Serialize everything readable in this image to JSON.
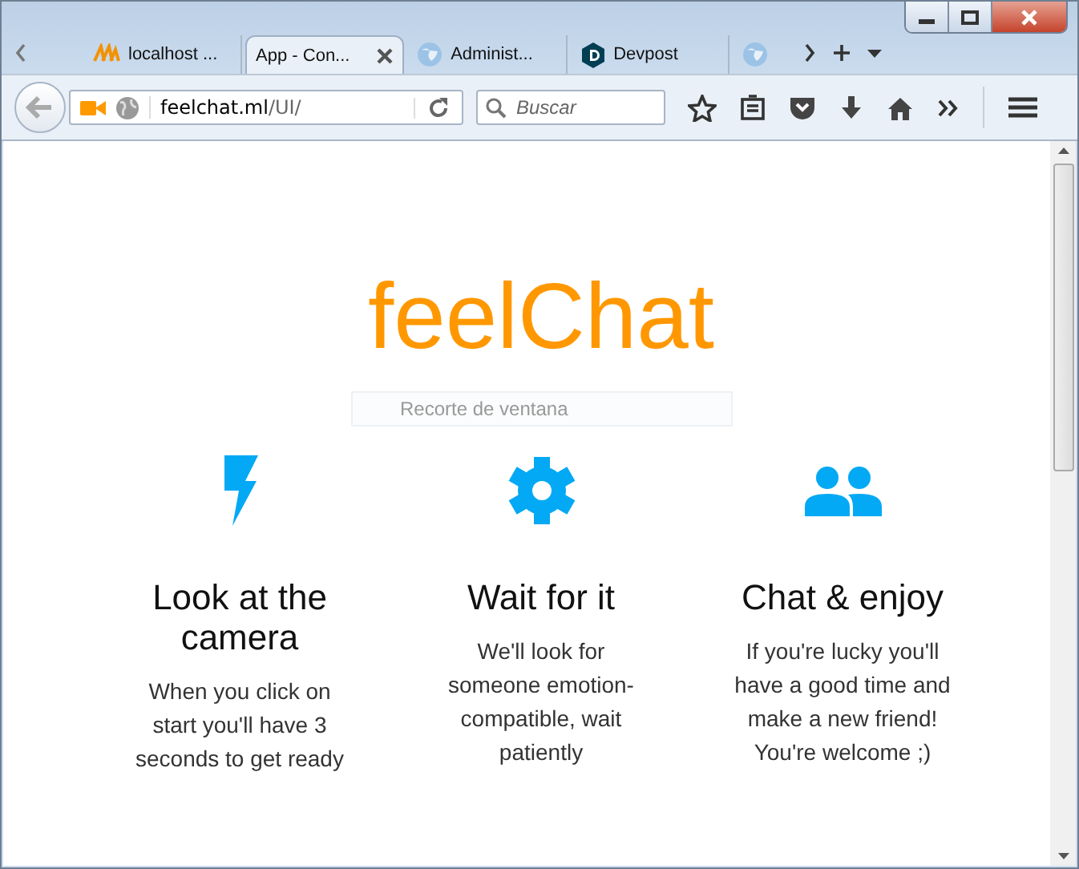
{
  "tabs": [
    {
      "title": "localhost ...",
      "kind": "sail",
      "selected": false
    },
    {
      "title": "App - Con...",
      "kind": "plain",
      "selected": true
    },
    {
      "title": "Administ...",
      "kind": "globe",
      "selected": false
    },
    {
      "title": "Devpost",
      "kind": "hexagon",
      "selected": false
    },
    {
      "kind": "globe",
      "selected": false
    }
  ],
  "address": {
    "host": "feelchat.ml",
    "path": "/UI/"
  },
  "search": {
    "placeholder": "Buscar"
  },
  "page": {
    "logo": "feelChat",
    "capture_field": {
      "placeholder": "Recorte de ventana"
    },
    "features": [
      {
        "kind": "bolt",
        "title": "Look at the camera",
        "text": "When you click on start you'll have 3 seconds to get ready"
      },
      {
        "kind": "gear",
        "title": "Wait for it",
        "text": "We'll look for someone emotion-compatible, wait patiently"
      },
      {
        "kind": "people",
        "title": "Chat & enjoy",
        "text": "If you're lucky you'll have a good time and make a new friend! You're welcome ;)"
      }
    ]
  }
}
